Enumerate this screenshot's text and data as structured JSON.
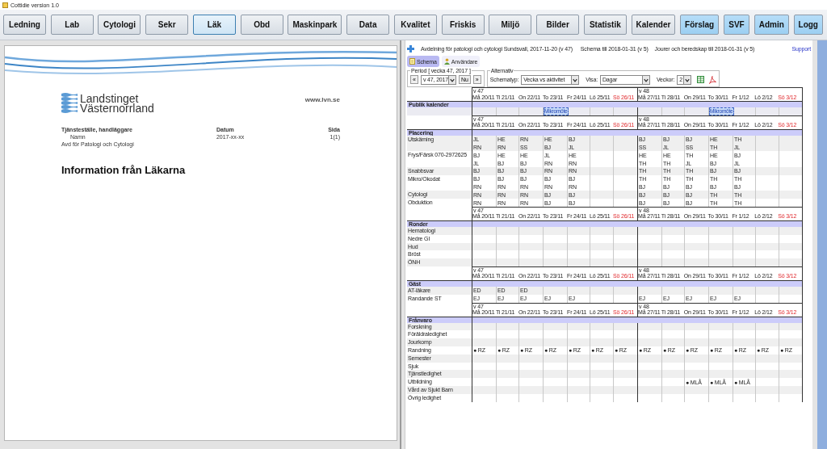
{
  "window": {
    "title": "Cottidie version 1.0"
  },
  "toolbar": [
    {
      "label": "Ledning",
      "kind": "module",
      "selected": false
    },
    {
      "label": "Lab",
      "kind": "module",
      "selected": false
    },
    {
      "label": "Cytologi",
      "kind": "module",
      "selected": false
    },
    {
      "label": "Sekr",
      "kind": "module",
      "selected": false
    },
    {
      "label": "Läk",
      "kind": "module",
      "selected": true
    },
    {
      "label": "Obd",
      "kind": "module",
      "selected": false
    },
    {
      "label": "Maskinpark",
      "kind": "module",
      "selected": false
    },
    {
      "label": "Data",
      "kind": "module",
      "selected": false
    },
    {
      "label": "Kvalitet",
      "kind": "module",
      "selected": false
    },
    {
      "label": "Friskis",
      "kind": "module",
      "selected": false
    },
    {
      "label": "Miljö",
      "kind": "module",
      "selected": false
    },
    {
      "label": "Bilder",
      "kind": "module",
      "selected": false
    },
    {
      "label": "Statistik",
      "kind": "module",
      "selected": false
    },
    {
      "label": "Kalender",
      "kind": "module",
      "selected": false
    },
    {
      "label": "Förslag",
      "kind": "action",
      "selected": false
    },
    {
      "label": "SVF",
      "kind": "action",
      "selected": false
    },
    {
      "label": "Admin",
      "kind": "action",
      "selected": false
    },
    {
      "label": "Logg",
      "kind": "action",
      "selected": false
    }
  ],
  "document": {
    "organization": [
      "Landstinget",
      "Västernorrland"
    ],
    "website": "www.lvn.se",
    "meta": [
      {
        "label": "Tjänsteställe, handläggare",
        "value": "Namn"
      },
      {
        "label": "Datum",
        "value": "2017-xx-xx"
      },
      {
        "label": "Sida",
        "value": "1(1)"
      }
    ],
    "unit": "Avd för Patologi och Cytologi",
    "heading": "Information från Läkarna"
  },
  "schedule_page": {
    "department": "Avdelning för patologi och cytologi Sundsvall, 2017-11-20 (v 47)",
    "schedule_until": "Schema till 2018-01-31 (v 5)",
    "duty_until": "Jourer och beredskap till 2018-01-31 (v 5)",
    "support_link": "Support",
    "tabs": [
      {
        "label": "Schema",
        "selected": true
      },
      {
        "label": "Användare",
        "selected": false
      }
    ],
    "period": {
      "legend": "Period [ vecka 47, 2017 ]",
      "prev": "«",
      "week": "v 47, 2017",
      "now": "Nu",
      "next": "»"
    },
    "options": {
      "legend": "Alternativ",
      "fields": [
        {
          "label": "Schematyp:",
          "value": "Vecka vs aktivitet"
        },
        {
          "label": "Visa:",
          "value": "Dagar"
        },
        {
          "label": "Veckor:",
          "value": "2"
        }
      ]
    },
    "sections": [
      {
        "title": "Publik kalender",
        "kind": "calendar",
        "weeks": [
          {
            "week": "v 47",
            "days": [
              {
                "label": "Må 20/11",
                "holiday": false
              },
              {
                "label": "Ti 21/11",
                "holiday": false
              },
              {
                "label": "On 22/11",
                "holiday": false
              },
              {
                "label": "To 23/11",
                "holiday": false
              },
              {
                "label": "Fr 24/11",
                "holiday": false
              },
              {
                "label": "Lö 25/11",
                "holiday": false
              },
              {
                "label": "Sö 26/11",
                "holiday": true
              }
            ]
          },
          {
            "week": "v 48",
            "days": [
              {
                "label": "Må 27/11",
                "holiday": false
              },
              {
                "label": "Ti 28/11",
                "holiday": false
              },
              {
                "label": "On 29/11",
                "holiday": false
              },
              {
                "label": "To 30/11",
                "holiday": false
              },
              {
                "label": "Fr 1/12",
                "holiday": false
              },
              {
                "label": "Lö 2/12",
                "holiday": false
              },
              {
                "label": "Sö 3/12",
                "holiday": true
              }
            ]
          }
        ],
        "rows": [
          {
            "lines": [
              {
                "week_1": {
                  "thu": "Mikromöte"
                },
                "week_2": {
                  "thu": "Mikromöte"
                }
              }
            ]
          }
        ]
      },
      {
        "title": "Placering",
        "kind": "assignments",
        "weeks": [
          {
            "week": "v 47",
            "days": [
              {
                "label": "Må 20/11",
                "holiday": false
              },
              {
                "label": "Ti 21/11",
                "holiday": false
              },
              {
                "label": "On 22/11",
                "holiday": false
              },
              {
                "label": "To 23/11",
                "holiday": false
              },
              {
                "label": "Fr 24/11",
                "holiday": false
              },
              {
                "label": "Lö 25/11",
                "holiday": false
              },
              {
                "label": "Sö 26/11",
                "holiday": true
              }
            ]
          },
          {
            "week": "v 48",
            "days": [
              {
                "label": "Må 27/11",
                "holiday": false
              },
              {
                "label": "Ti 28/11",
                "holiday": false
              },
              {
                "label": "On 29/11",
                "holiday": false
              },
              {
                "label": "To 30/11",
                "holiday": false
              },
              {
                "label": "Fr 1/12",
                "holiday": false
              },
              {
                "label": "Lö 2/12",
                "holiday": false
              },
              {
                "label": "Sö 3/12",
                "holiday": true
              }
            ]
          }
        ],
        "rows": [
          {
            "label": "Utskärning",
            "lines": [
              {
                "week_1": {
                  "mon": "JL",
                  "tue": "HE",
                  "wed": "RN",
                  "thu": "HE",
                  "fri": "BJ"
                },
                "week_2": {
                  "mon": "BJ",
                  "tue": "BJ",
                  "wed": "BJ",
                  "thu": "HE",
                  "fri": "TH"
                }
              },
              {
                "week_1": {
                  "mon": "RN",
                  "tue": "RN",
                  "wed": "SS",
                  "thu": "BJ",
                  "fri": "JL"
                },
                "week_2": {
                  "mon": "SS",
                  "tue": "JL",
                  "wed": "SS",
                  "thu": "TH",
                  "fri": "JL"
                }
              }
            ]
          },
          {
            "label": "Frys/Färsk 070-2972625",
            "lines": [
              {
                "week_1": {
                  "mon": "BJ",
                  "tue": "HE",
                  "wed": "HE",
                  "thu": "JL",
                  "fri": "HE"
                },
                "week_2": {
                  "mon": "HE",
                  "tue": "HE",
                  "wed": "TH",
                  "thu": "HE",
                  "fri": "BJ"
                }
              },
              {
                "week_1": {
                  "mon": "JL",
                  "tue": "BJ",
                  "wed": "BJ",
                  "thu": "RN",
                  "fri": "RN"
                },
                "week_2": {
                  "mon": "TH",
                  "tue": "TH",
                  "wed": "JL",
                  "thu": "BJ",
                  "fri": "JL"
                }
              }
            ]
          },
          {
            "label": "Snabbsvar",
            "lines": [
              {
                "week_1": {
                  "mon": "BJ",
                  "tue": "BJ",
                  "wed": "BJ",
                  "thu": "RN",
                  "fri": "RN"
                },
                "week_2": {
                  "mon": "TH",
                  "tue": "TH",
                  "wed": "TH",
                  "thu": "BJ",
                  "fri": "BJ"
                }
              }
            ]
          },
          {
            "label": "Mikro/Okodat",
            "lines": [
              {
                "week_1": {
                  "mon": "BJ",
                  "tue": "BJ",
                  "wed": "BJ",
                  "thu": "BJ",
                  "fri": "BJ"
                },
                "week_2": {
                  "mon": "TH",
                  "tue": "TH",
                  "wed": "TH",
                  "thu": "TH",
                  "fri": "TH"
                }
              },
              {
                "week_1": {
                  "mon": "RN",
                  "tue": "RN",
                  "wed": "RN",
                  "thu": "RN",
                  "fri": "RN"
                },
                "week_2": {
                  "mon": "BJ",
                  "tue": "BJ",
                  "wed": "BJ",
                  "thu": "BJ",
                  "fri": "BJ"
                }
              }
            ]
          },
          {
            "label": "Cytologi",
            "lines": [
              {
                "week_1": {
                  "mon": "RN",
                  "tue": "RN",
                  "wed": "RN",
                  "thu": "BJ",
                  "fri": "BJ"
                },
                "week_2": {
                  "mon": "BJ",
                  "tue": "BJ",
                  "wed": "BJ",
                  "thu": "TH",
                  "fri": "TH"
                }
              }
            ]
          },
          {
            "label": "Obduktion",
            "lines": [
              {
                "week_1": {
                  "mon": "RN",
                  "tue": "RN",
                  "wed": "RN",
                  "thu": "BJ",
                  "fri": "BJ"
                },
                "week_2": {
                  "mon": "BJ",
                  "tue": "BJ",
                  "wed": "BJ",
                  "thu": "TH",
                  "fri": "TH"
                }
              }
            ]
          }
        ]
      },
      {
        "title": "Ronder",
        "kind": "assignments",
        "weeks": [
          {
            "week": "v 47",
            "days": [
              {
                "label": "Må 20/11",
                "holiday": false
              },
              {
                "label": "Ti 21/11",
                "holiday": false
              },
              {
                "label": "On 22/11",
                "holiday": false
              },
              {
                "label": "To 23/11",
                "holiday": false
              },
              {
                "label": "Fr 24/11",
                "holiday": false
              },
              {
                "label": "Lö 25/11",
                "holiday": false
              },
              {
                "label": "Sö 26/11",
                "holiday": true
              }
            ]
          },
          {
            "week": "v 48",
            "days": [
              {
                "label": "Må 27/11",
                "holiday": false
              },
              {
                "label": "Ti 28/11",
                "holiday": false
              },
              {
                "label": "On 29/11",
                "holiday": false
              },
              {
                "label": "To 30/11",
                "holiday": false
              },
              {
                "label": "Fr 1/12",
                "holiday": false
              },
              {
                "label": "Lö 2/12",
                "holiday": false
              },
              {
                "label": "Sö 3/12",
                "holiday": true
              }
            ]
          }
        ],
        "rows": [
          {
            "label": "Hematologi"
          },
          {
            "label": "Nedre GI"
          },
          {
            "label": "Hud"
          },
          {
            "label": "Bröst"
          },
          {
            "label": "ÖNH"
          }
        ]
      },
      {
        "title": "Gäst",
        "kind": "assignments",
        "weeks": [
          {
            "week": "v 47",
            "days": [
              {
                "label": "Må 20/11",
                "holiday": false
              },
              {
                "label": "Ti 21/11",
                "holiday": false
              },
              {
                "label": "On 22/11",
                "holiday": false
              },
              {
                "label": "To 23/11",
                "holiday": false
              },
              {
                "label": "Fr 24/11",
                "holiday": false
              },
              {
                "label": "Lö 25/11",
                "holiday": false
              },
              {
                "label": "Sö 26/11",
                "holiday": true
              }
            ]
          },
          {
            "week": "v 48",
            "days": [
              {
                "label": "Må 27/11",
                "holiday": false
              },
              {
                "label": "Ti 28/11",
                "holiday": false
              },
              {
                "label": "On 29/11",
                "holiday": false
              },
              {
                "label": "To 30/11",
                "holiday": false
              },
              {
                "label": "Fr 1/12",
                "holiday": false
              },
              {
                "label": "Lö 2/12",
                "holiday": false
              },
              {
                "label": "Sö 3/12",
                "holiday": true
              }
            ]
          }
        ],
        "rows": [
          {
            "label": "AT-läkare",
            "lines": [
              {
                "week_1": {
                  "mon": "ED",
                  "tue": "ED",
                  "wed": "ED"
                }
              }
            ]
          },
          {
            "label": "Randande ST",
            "lines": [
              {
                "week_1": {
                  "mon": "EJ",
                  "tue": "EJ",
                  "wed": "EJ",
                  "thu": "EJ",
                  "fri": "EJ"
                },
                "week_2": {
                  "mon": "EJ",
                  "tue": "EJ",
                  "wed": "EJ",
                  "thu": "EJ",
                  "fri": "EJ"
                }
              }
            ]
          }
        ]
      },
      {
        "title": "Frånvaro",
        "kind": "assignments",
        "weeks": [
          {
            "week": "v 47",
            "days": [
              {
                "label": "Må 20/11",
                "holiday": false
              },
              {
                "label": "Ti 21/11",
                "holiday": false
              },
              {
                "label": "On 22/11",
                "holiday": false
              },
              {
                "label": "To 23/11",
                "holiday": false
              },
              {
                "label": "Fr 24/11",
                "holiday": false
              },
              {
                "label": "Lö 25/11",
                "holiday": false
              },
              {
                "label": "Sö 26/11",
                "holiday": true
              }
            ]
          },
          {
            "week": "v 48",
            "days": [
              {
                "label": "Må 27/11",
                "holiday": false
              },
              {
                "label": "Ti 28/11",
                "holiday": false
              },
              {
                "label": "On 29/11",
                "holiday": false
              },
              {
                "label": "To 30/11",
                "holiday": false
              },
              {
                "label": "Fr 1/12",
                "holiday": false
              },
              {
                "label": "Lö 2/12",
                "holiday": false
              },
              {
                "label": "Sö 3/12",
                "holiday": true
              }
            ]
          }
        ],
        "rows": [
          {
            "label": "Forskning"
          },
          {
            "label": "Föräldraledighet"
          },
          {
            "label": "Jourkomp"
          },
          {
            "label": "Randning",
            "lines": [
              {
                "week_1": {
                  "mon": "● RZ",
                  "tue": "● RZ",
                  "wed": "● RZ",
                  "thu": "● RZ",
                  "fri": "● RZ",
                  "sat": "● RZ",
                  "sun": "● RZ"
                },
                "week_2": {
                  "mon": "● RZ",
                  "tue": "● RZ",
                  "wed": "● RZ",
                  "thu": "● RZ",
                  "fri": "● RZ",
                  "sat": "● RZ",
                  "sun": "● RZ"
                }
              }
            ]
          },
          {
            "label": "Semester"
          },
          {
            "label": "Sjuk"
          },
          {
            "label": "Tjänstledighet"
          },
          {
            "label": "Utbildning",
            "lines": [
              {
                "week_2": {
                  "wed": "● MLÅ",
                  "thu": "● MLÅ",
                  "fri": "● MLÅ"
                }
              }
            ]
          },
          {
            "label": "Vård av Sjukt Barn"
          },
          {
            "label": "Övrig ledighet"
          }
        ]
      }
    ]
  }
}
